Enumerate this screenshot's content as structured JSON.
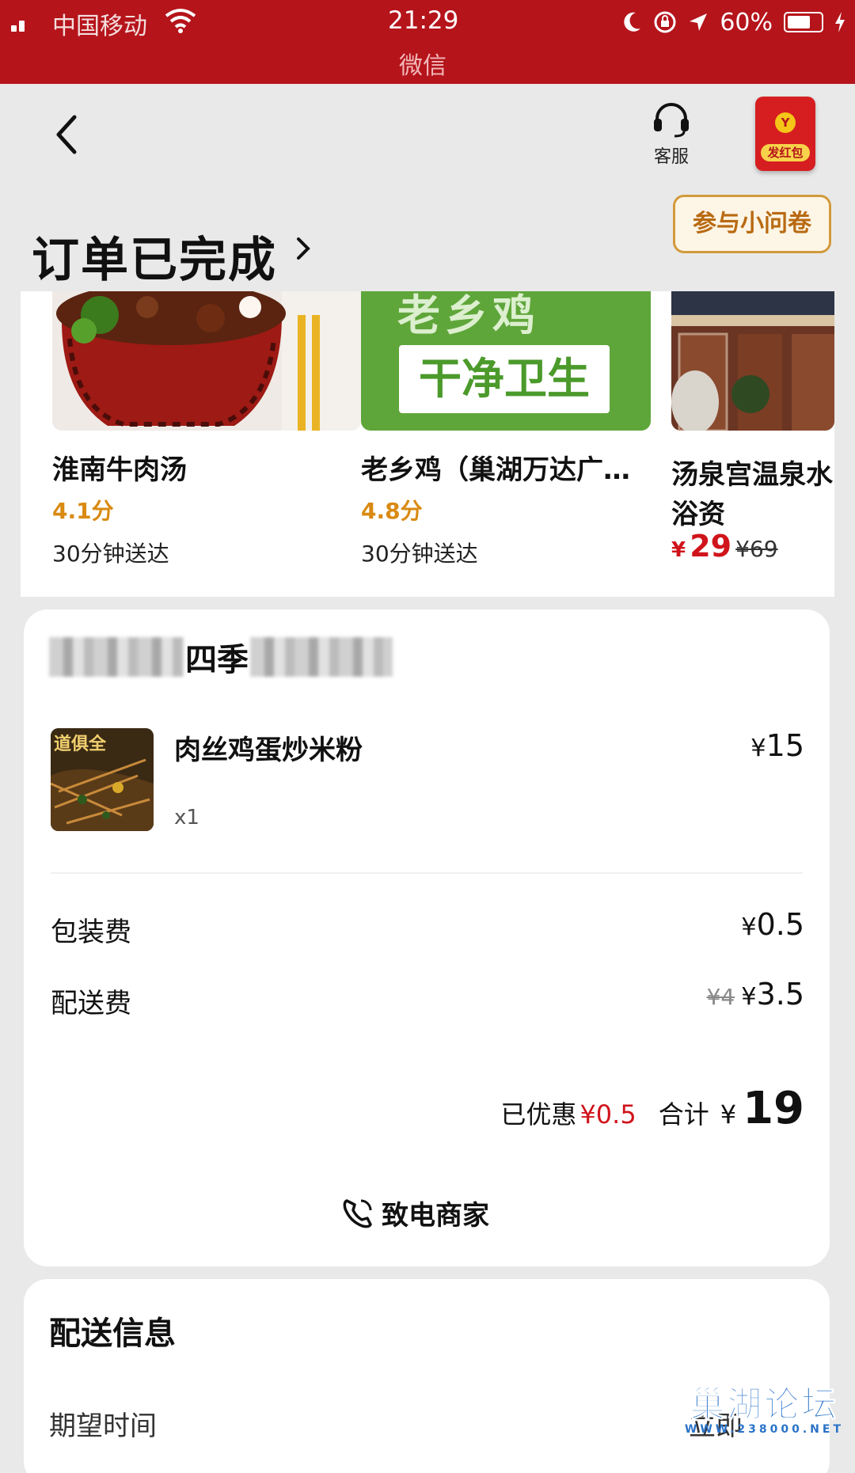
{
  "status_bar": {
    "carrier": "中国移动",
    "time": "21:29",
    "app": "微信",
    "battery": "60%"
  },
  "header": {
    "service_label": "客服",
    "redpack_label": "发红包",
    "redpack_coin": "Y",
    "title": "订单已完成",
    "survey_label": "参与小问卷"
  },
  "recommendations": [
    {
      "name": "淮南牛肉汤",
      "score": "4.1分",
      "eta": "30分钟送达"
    },
    {
      "name": "老乡鸡（巢湖万达广…",
      "score": "4.8分",
      "eta": "30分钟送达",
      "banner_top": "老乡鸡",
      "banner_text": "干净卫生"
    },
    {
      "name_line1": "汤泉宫温泉水",
      "name_line2": "浴资",
      "price_symbol": "¥",
      "price": "29",
      "original_price": "¥69"
    }
  ],
  "order": {
    "shop_name_visible": "四季",
    "item": {
      "name": "肉丝鸡蛋炒米粉",
      "qty": "x1",
      "price_symbol": "¥",
      "price": "15",
      "img_text": "道俱全"
    },
    "packaging_label": "包装费",
    "packaging_symbol": "¥",
    "packaging_value": "0.5",
    "delivery_label": "配送费",
    "delivery_original": "¥4",
    "delivery_symbol": "¥",
    "delivery_value": "3.5",
    "discount_label": "已优惠",
    "discount_value": "¥0.5",
    "total_label": "合计",
    "total_symbol": "¥",
    "total_value": "19",
    "call_label": "致电商家"
  },
  "delivery": {
    "title": "配送信息",
    "expect_label": "期望时间",
    "expect_value_partial": "立即"
  },
  "watermark": {
    "main": "巢湖论坛",
    "sub": "WWW.238000.NET"
  }
}
